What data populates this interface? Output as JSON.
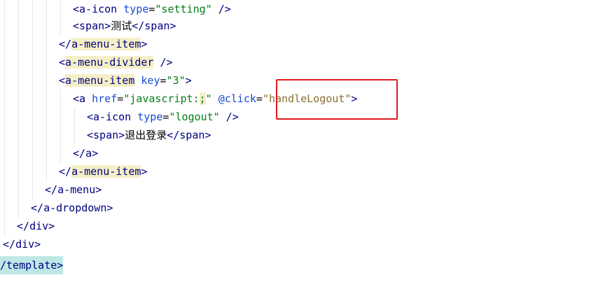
{
  "code": {
    "line1": {
      "open": "<",
      "tag": "a-icon",
      "attr": "type",
      "eq": "=",
      "value": "\"setting\"",
      "close": " />"
    },
    "line2": {
      "open_tag": "<",
      "tag": "span",
      "gt": ">",
      "text": "测试",
      "end_open": "</",
      "end_tag": "span",
      "end_gt": ">"
    },
    "line3": {
      "open": "</",
      "tag": "a-menu-item",
      "close": ">"
    },
    "line4": {
      "open": "<",
      "tag": "a-menu-divider",
      "close": " />"
    },
    "line5": {
      "open": "<",
      "tag": "a-menu-item",
      "attr": " key",
      "eq": "=",
      "value": "\"3\"",
      "close": ">"
    },
    "line6": {
      "open": "<",
      "tag": "a",
      "attr1": " href",
      "eq1": "=",
      "value1_part1": "\"javascript:",
      "value1_semicolon": ";",
      "value1_part2": "\"",
      "attr2": " @click",
      "eq2": "=",
      "value2": "\"handleLogout\"",
      "close": ">"
    },
    "line7": {
      "open": "<",
      "tag": "a-icon",
      "attr": " type",
      "eq": "=",
      "value": "\"logout\"",
      "close": " />"
    },
    "line8": {
      "open_tag": "<",
      "tag": "span",
      "gt": ">",
      "text": "退出登录",
      "end_open": "</",
      "end_tag": "span",
      "end_gt": ">"
    },
    "line9": {
      "open": "</",
      "tag": "a",
      "close": ">"
    },
    "line10": {
      "open": "</",
      "tag": "a-menu-item",
      "close": ">"
    },
    "line11": {
      "open": "</",
      "tag": "a-menu",
      "close": ">"
    },
    "line12": {
      "open": "</",
      "tag": "a-dropdown",
      "close": ">"
    },
    "line13": {
      "open": "</",
      "tag": "div",
      "close": ">"
    },
    "line14": {
      "open": "</",
      "tag": "div",
      "close": ">"
    },
    "line15": {
      "open": "/",
      "tag": "template",
      "close": ">"
    }
  },
  "colors": {
    "tag": "#000080",
    "attribute": "#174ad4",
    "string": "#067d17",
    "highlight_box": "#e0191c",
    "tag_match_highlight": "#f5efc7",
    "template_highlight": "#bde8e6"
  }
}
